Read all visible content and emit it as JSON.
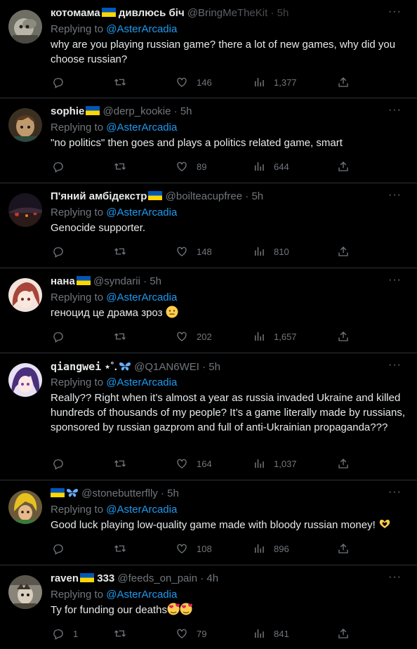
{
  "colors": {
    "background": "#000000",
    "text": "#e7e9ea",
    "muted": "#71767b",
    "link": "#1d9bf0",
    "divider": "#2f3336"
  },
  "icons": {
    "reply": "reply-icon",
    "retweet": "retweet-icon",
    "like": "like-icon",
    "views": "views-icon",
    "share": "share-icon",
    "more": "more-icon",
    "flag": "ukraine-flag-icon",
    "butterfly": "butterfly-icon"
  },
  "more_label": "···",
  "replying_label": "Replying to",
  "tweets": [
    {
      "name": "котомама",
      "name_suffix": "дивлюсь біч",
      "handle": "@BringMeTheKit",
      "time": "5h",
      "reply_to": "@AsterArcadia",
      "text": "why are you playing russian game? there a lot of new games, why did you choose russian?",
      "replies": "",
      "retweets": "",
      "likes": "146",
      "views": "1,377"
    },
    {
      "name": "sophie",
      "handle": "@derp_kookie",
      "time": "5h",
      "reply_to": "@AsterArcadia",
      "text": "\"no politics\" then goes and plays a politics related game, smart",
      "replies": "",
      "retweets": "",
      "likes": "89",
      "views": "644"
    },
    {
      "name": "П'яний амбідекстр",
      "handle": "@boilteacupfree",
      "time": "5h",
      "reply_to": "@AsterArcadia",
      "text": "Genocide supporter.",
      "replies": "",
      "retweets": "",
      "likes": "148",
      "views": "810"
    },
    {
      "name": "нана",
      "handle": "@syndarii",
      "time": "5h",
      "reply_to": "@AsterArcadia",
      "text": "геноцид це драма зроз",
      "replies": "",
      "retweets": "",
      "likes": "202",
      "views": "1,657"
    },
    {
      "name": "qiangwei",
      "name_suffix": "⋆˚.",
      "handle": "@Q1AN6WEI",
      "time": "5h",
      "reply_to": "@AsterArcadia",
      "text": "Really?? Right when it’s almost a year as russia invaded Ukraine and killed hundreds of thousands of my people? It’s a game literally made by russians, sponsored by russian gazprom and full of anti-Ukrainian propaganda???",
      "replies": "",
      "retweets": "",
      "likes": "164",
      "views": "1,037"
    },
    {
      "name": "",
      "handle": "@stonebutterflly",
      "time": "5h",
      "reply_to": "@AsterArcadia",
      "text": "Good luck playing low-quality game made with bloody russian money!",
      "replies": "",
      "retweets": "",
      "likes": "108",
      "views": "896"
    },
    {
      "name": "raven",
      "name_suffix": "333",
      "handle": "@feeds_on_pain",
      "time": "4h",
      "reply_to": "@AsterArcadia",
      "text": "Ty for funding our deaths",
      "replies": "1",
      "retweets": "",
      "likes": "79",
      "views": "841"
    }
  ]
}
